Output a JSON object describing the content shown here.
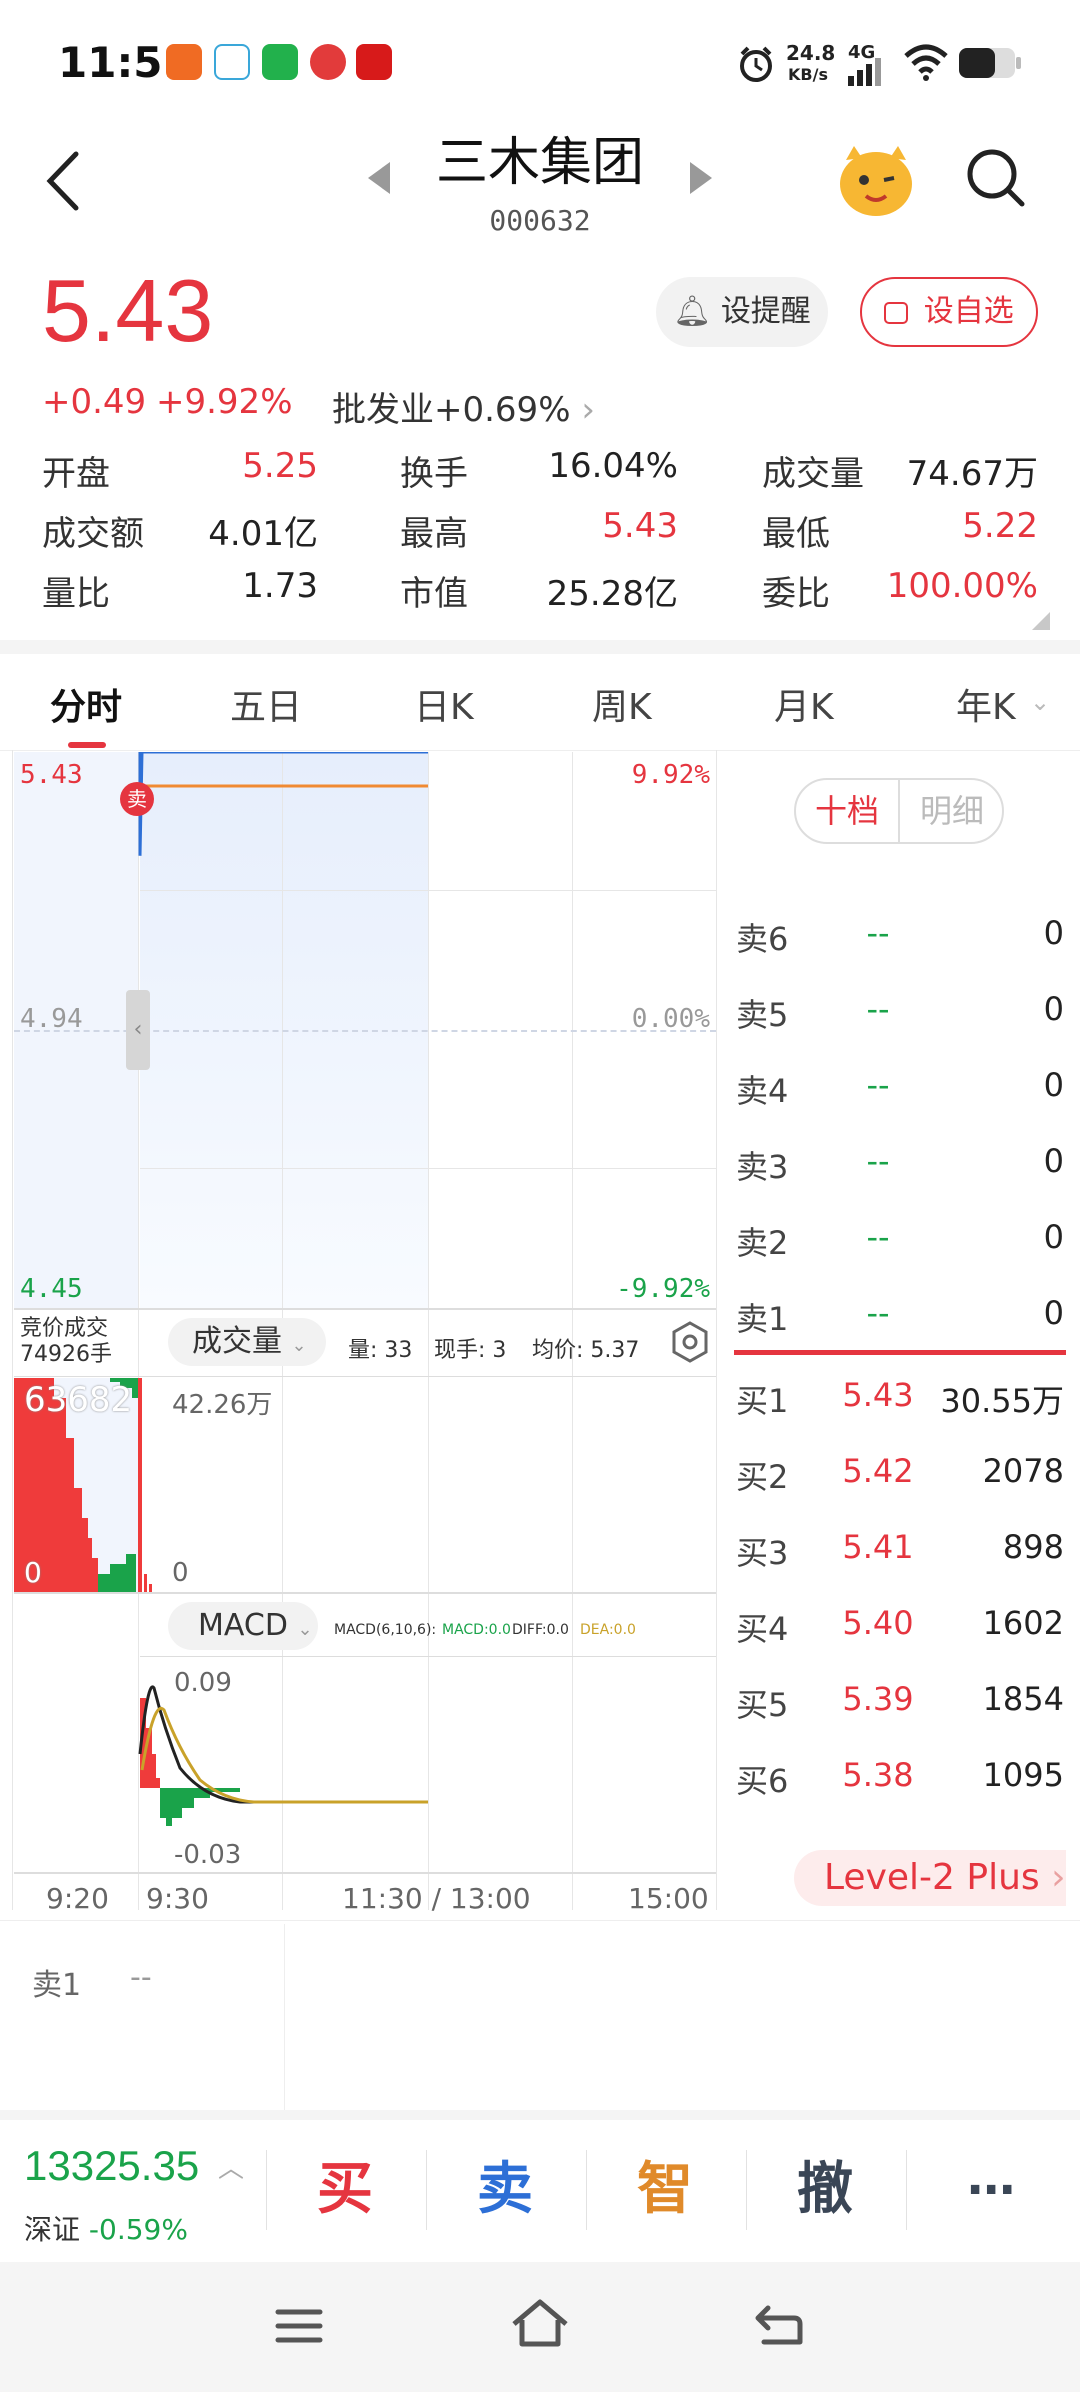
{
  "status_bar": {
    "time": "11:51",
    "net_speed": "24.8",
    "net_unit": "KB/s",
    "net_type": "4G"
  },
  "header": {
    "title": "三木集团",
    "code": "000632",
    "back_icon": "back-chevron-icon",
    "search_icon": "search-icon"
  },
  "quote": {
    "price": "5.43",
    "change": "+0.49",
    "change_pct": "+9.92%",
    "sector": "批发业+0.69%",
    "alert_label": "设提醒",
    "watch_label": "设自选"
  },
  "stats": [
    {
      "label": "开盘",
      "value": "5.25",
      "color": "#e5353f"
    },
    {
      "label": "换手",
      "value": "16.04%",
      "color": "#222"
    },
    {
      "label": "成交量",
      "value": "74.67万",
      "color": "#222"
    },
    {
      "label": "成交额",
      "value": "4.01亿",
      "color": "#222"
    },
    {
      "label": "最高",
      "value": "5.43",
      "color": "#e5353f"
    },
    {
      "label": "最低",
      "value": "5.22",
      "color": "#e5353f"
    },
    {
      "label": "量比",
      "value": "1.73",
      "color": "#222"
    },
    {
      "label": "市值",
      "value": "25.28亿",
      "color": "#222"
    },
    {
      "label": "委比",
      "value": "100.00%",
      "color": "#e5353f"
    }
  ],
  "tabs": [
    "分时",
    "五日",
    "日K",
    "周K",
    "月K",
    "年K"
  ],
  "chart": {
    "price_high": "5.43",
    "price_mid": "4.94",
    "price_low": "4.45",
    "pct_high": "9.92%",
    "pct_mid": "0.00%",
    "pct_low": "-9.92%",
    "auction_label": "竞价成交",
    "auction_volume": "74926手",
    "volume_indicator": "成交量",
    "vol_info": "量: 33",
    "hand_info": "现手: 3",
    "avg_info": "均价: 5.37",
    "auction_vol_max": "63682",
    "auction_vol_zero": "0",
    "vol_max": "42.26万",
    "vol_zero": "0",
    "macd_indicator": "MACD",
    "macd_params": "MACD(6,10,6):",
    "macd_val": "MACD:0.0",
    "diff_val": "DIFF:0.0",
    "dea_val": "DEA:0.0",
    "macd_high": "0.09",
    "macd_low": "-0.03",
    "time_labels": [
      "9:20",
      "9:30",
      "11:30 / 13:00",
      "15:00"
    ],
    "sell_marker": "卖"
  },
  "chart_data": {
    "type": "line",
    "x": [
      "9:30",
      "9:31",
      "9:35",
      "10:00",
      "10:30",
      "11:00",
      "11:30"
    ],
    "series": [
      {
        "values": [
          5.3,
          5.43,
          5.43,
          5.43,
          5.43,
          5.43,
          5.43
        ]
      }
    ],
    "ylim": [
      4.45,
      5.43
    ]
  },
  "orderbook": {
    "tab_active": "十档",
    "tab_inactive": "明细",
    "sells": [
      {
        "label": "卖6",
        "price": "--",
        "qty": "0"
      },
      {
        "label": "卖5",
        "price": "--",
        "qty": "0"
      },
      {
        "label": "卖4",
        "price": "--",
        "qty": "0"
      },
      {
        "label": "卖3",
        "price": "--",
        "qty": "0"
      },
      {
        "label": "卖2",
        "price": "--",
        "qty": "0"
      },
      {
        "label": "卖1",
        "price": "--",
        "qty": "0"
      }
    ],
    "buys": [
      {
        "label": "买1",
        "price": "5.43",
        "qty": "30.55万"
      },
      {
        "label": "买2",
        "price": "5.42",
        "qty": "2078"
      },
      {
        "label": "买3",
        "price": "5.41",
        "qty": "898"
      },
      {
        "label": "买4",
        "price": "5.40",
        "qty": "1602"
      },
      {
        "label": "买5",
        "price": "5.39",
        "qty": "1854"
      },
      {
        "label": "买6",
        "price": "5.38",
        "qty": "1095"
      }
    ],
    "level2_label": "Level-2 Plus"
  },
  "ticker": {
    "label": "卖1",
    "value": "--"
  },
  "toolbar": {
    "index_value": "13325.35",
    "index_name": "深证",
    "index_change": "-0.59%",
    "buy": "买",
    "sell": "卖",
    "smart": "智",
    "cancel": "撤",
    "more": "⋯"
  },
  "colors": {
    "up": "#e5353f",
    "down": "#1aa34a",
    "accent": "#e5353f"
  }
}
